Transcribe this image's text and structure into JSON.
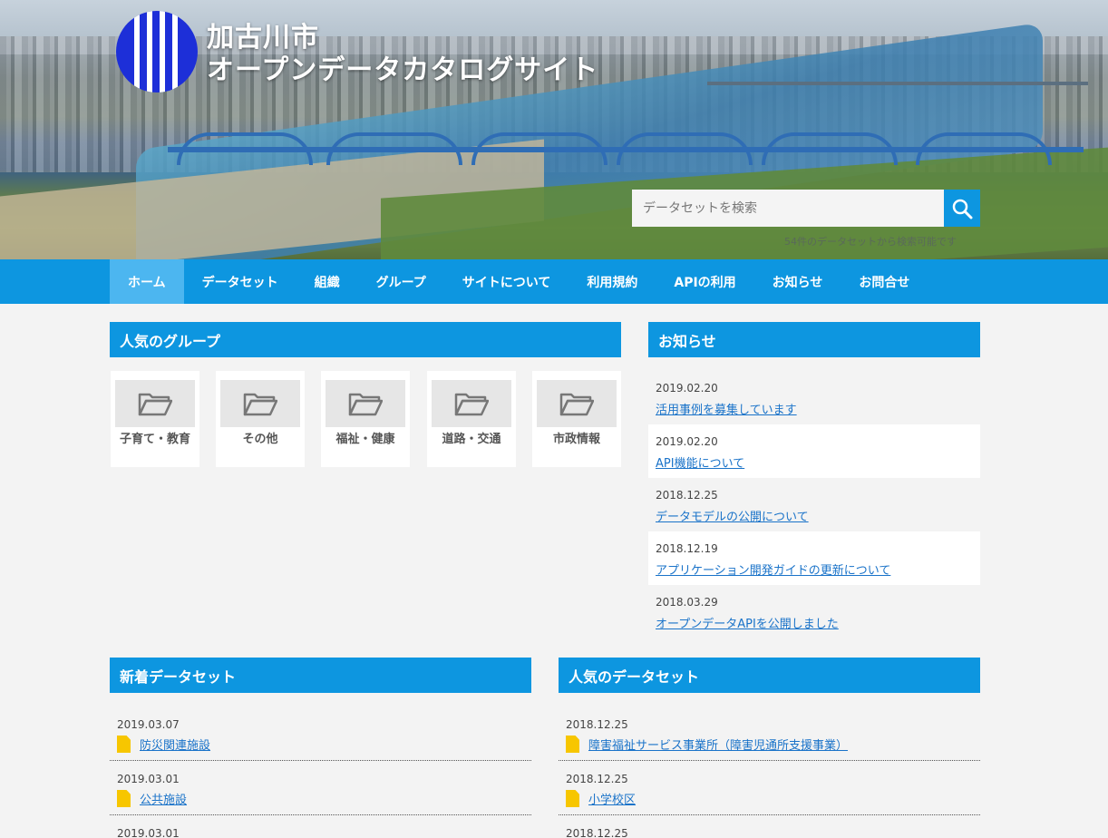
{
  "site": {
    "title_line1": "加古川市",
    "title_line2": "オープンデータカタログサイト"
  },
  "search": {
    "placeholder": "データセットを検索",
    "note": "54件のデータセットから検索可能です"
  },
  "nav": {
    "items": [
      "ホーム",
      "データセット",
      "組織",
      "グループ",
      "サイトについて",
      "利用規約",
      "APIの利用",
      "お知らせ",
      "お問合せ"
    ],
    "active": "ホーム"
  },
  "popular_groups": {
    "heading": "人気のグループ",
    "items": [
      "子育て・教育",
      "その他",
      "福祉・健康",
      "道路・交通",
      "市政情報"
    ]
  },
  "news": {
    "heading": "お知らせ",
    "items": [
      {
        "date": "2019.02.20",
        "title": "活用事例を募集しています"
      },
      {
        "date": "2019.02.20",
        "title": "API機能について"
      },
      {
        "date": "2018.12.25",
        "title": "データモデルの公開について"
      },
      {
        "date": "2018.12.19",
        "title": "アプリケーション開発ガイドの更新について"
      },
      {
        "date": "2018.03.29",
        "title": "オープンデータAPIを公開しました"
      }
    ]
  },
  "new_datasets": {
    "heading": "新着データセット",
    "items": [
      {
        "date": "2019.03.07",
        "title": "防災関連施設"
      },
      {
        "date": "2019.03.01",
        "title": "公共施設"
      },
      {
        "date": "2019.03.01",
        "title": ""
      }
    ]
  },
  "popular_datasets": {
    "heading": "人気のデータセット",
    "items": [
      {
        "date": "2018.12.25",
        "title": "障害福祉サービス事業所（障害児通所支援事業）"
      },
      {
        "date": "2018.12.25",
        "title": "小学校区"
      },
      {
        "date": "2018.12.25",
        "title": ""
      }
    ]
  },
  "colors": {
    "accent": "#0d96e0",
    "nav_active": "#4cb6f0",
    "link": "#1a73c9",
    "file_icon": "#f7c600"
  }
}
